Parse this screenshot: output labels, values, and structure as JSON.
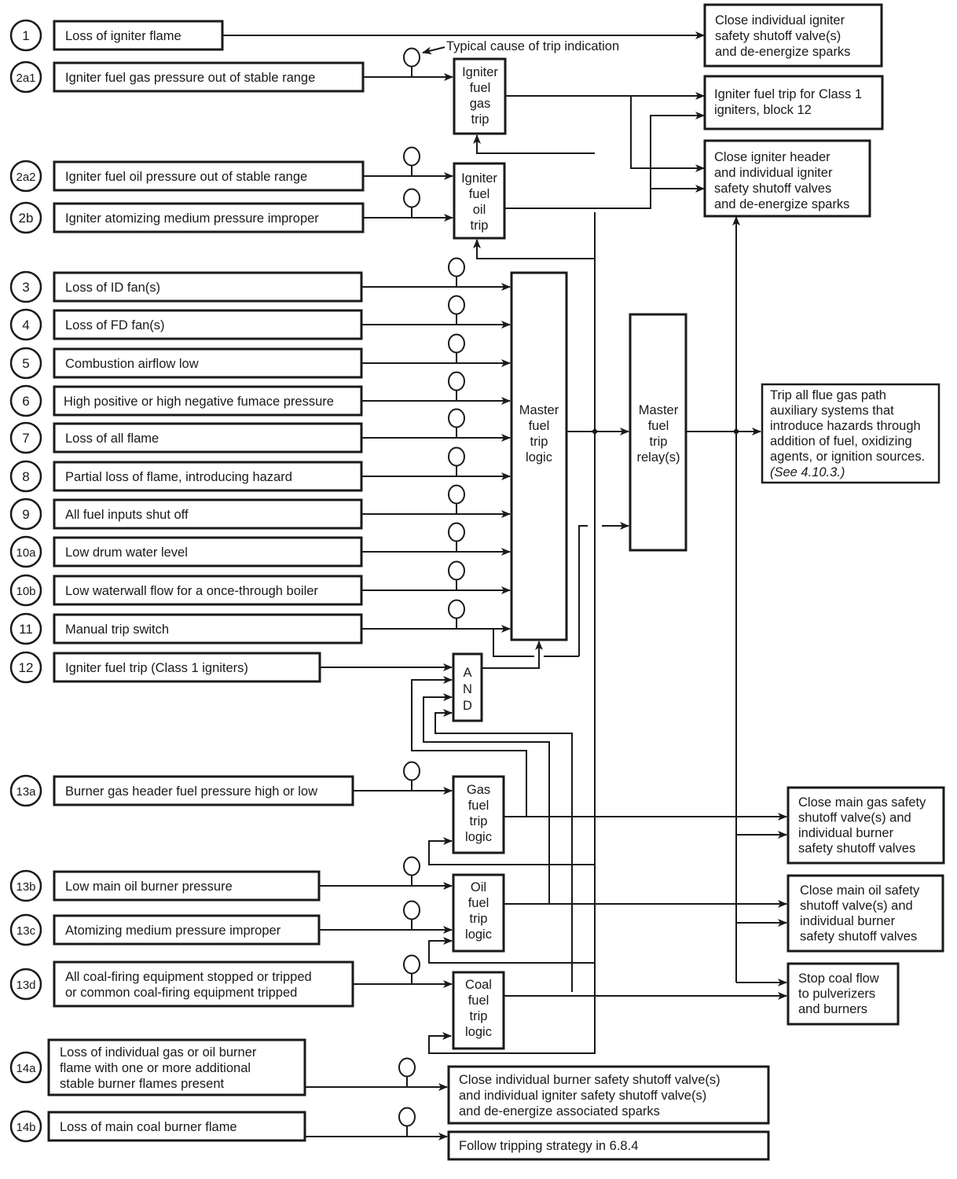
{
  "figure": {
    "annotation": "Typical cause of trip indication"
  },
  "inputs": [
    {
      "id": "1",
      "label": [
        "Loss of igniter flame"
      ]
    },
    {
      "id": "2a1",
      "label": [
        "Igniter fuel gas pressure out of stable range"
      ]
    },
    {
      "id": "2a2",
      "label": [
        "Igniter fuel oil pressure out of stable range"
      ]
    },
    {
      "id": "2b",
      "label": [
        "Igniter atomizing medium pressure improper"
      ]
    },
    {
      "id": "3",
      "label": [
        "Loss of ID fan(s)"
      ]
    },
    {
      "id": "4",
      "label": [
        "Loss of FD fan(s)"
      ]
    },
    {
      "id": "5",
      "label": [
        "Combustion airflow low"
      ]
    },
    {
      "id": "6",
      "label": [
        "High positive or high negative fumace pressure"
      ]
    },
    {
      "id": "7",
      "label": [
        "Loss of all flame"
      ]
    },
    {
      "id": "8",
      "label": [
        "Partial loss of flame, introducing hazard"
      ]
    },
    {
      "id": "9",
      "label": [
        "All fuel inputs shut off"
      ]
    },
    {
      "id": "10a",
      "label": [
        "Low drum water level"
      ]
    },
    {
      "id": "10b",
      "label": [
        "Low waterwall flow for a once-through boiler"
      ]
    },
    {
      "id": "11",
      "label": [
        "Manual trip switch"
      ]
    },
    {
      "id": "12",
      "label": [
        "Igniter fuel trip (Class 1 igniters)"
      ]
    },
    {
      "id": "13a",
      "label": [
        "Burner gas header fuel pressure high or low"
      ]
    },
    {
      "id": "13b",
      "label": [
        "Low main oil burner pressure"
      ]
    },
    {
      "id": "13c",
      "label": [
        "Atomizing medium pressure improper"
      ]
    },
    {
      "id": "13d",
      "label": [
        "All coal-firing equipment stopped or tripped",
        "or common coal-firing equipment tripped"
      ]
    },
    {
      "id": "14a",
      "label": [
        "Loss of individual gas or oil burner",
        "flame with one or more additional",
        "stable burner flames present"
      ]
    },
    {
      "id": "14b",
      "label": [
        "Loss of main coal burner flame"
      ]
    }
  ],
  "logic_blocks": {
    "igniter_gas_trip": [
      "Igniter",
      "fuel",
      "gas",
      "trip"
    ],
    "igniter_oil_trip": [
      "Igniter",
      "fuel",
      "oil",
      "trip"
    ],
    "master_logic": [
      "Master",
      "fuel",
      "trip",
      "logic"
    ],
    "master_relay": [
      "Master",
      "fuel",
      "trip",
      "relay(s)"
    ],
    "and_gate": [
      "A",
      "N",
      "D"
    ],
    "gas_fuel_trip": [
      "Gas",
      "fuel",
      "trip",
      "logic"
    ],
    "oil_fuel_trip": [
      "Oil",
      "fuel",
      "trip",
      "logic"
    ],
    "coal_fuel_trip": [
      "Coal",
      "fuel",
      "trip",
      "logic"
    ]
  },
  "outputs": {
    "close_individual_igniter": [
      "Close individual igniter",
      "safety shutoff valve(s)",
      "and de-energize sparks"
    ],
    "igniter_fuel_trip_class1": [
      "Igniter fuel trip for Class 1",
      "igniters, block 12"
    ],
    "close_igniter_header": [
      "Close igniter header",
      "and individual igniter",
      "safety shutoff valves",
      "and de-energize sparks"
    ],
    "trip_flue_gas": [
      "Trip all flue gas path",
      "auxiliary systems that",
      "introduce hazards through",
      "addition of fuel, oxidizing",
      "agents, or ignition sources."
    ],
    "trip_flue_gas_ref": "(See 4.10.3.)",
    "close_main_gas": [
      "Close main gas safety",
      "shutoff valve(s) and",
      "individual burner",
      "safety shutoff valves"
    ],
    "close_main_oil": [
      "Close main oil safety",
      "shutoff valve(s) and",
      "individual burner",
      "safety shutoff valves"
    ],
    "stop_coal": [
      "Stop coal flow",
      "to pulverizers",
      "and burners"
    ],
    "close_individual_burner": [
      "Close individual burner safety shutoff valve(s)",
      "and individual igniter safety shutoff valve(s)",
      "and de-energize associated sparks"
    ],
    "follow_strategy": [
      "Follow tripping strategy in 6.8.4"
    ]
  }
}
